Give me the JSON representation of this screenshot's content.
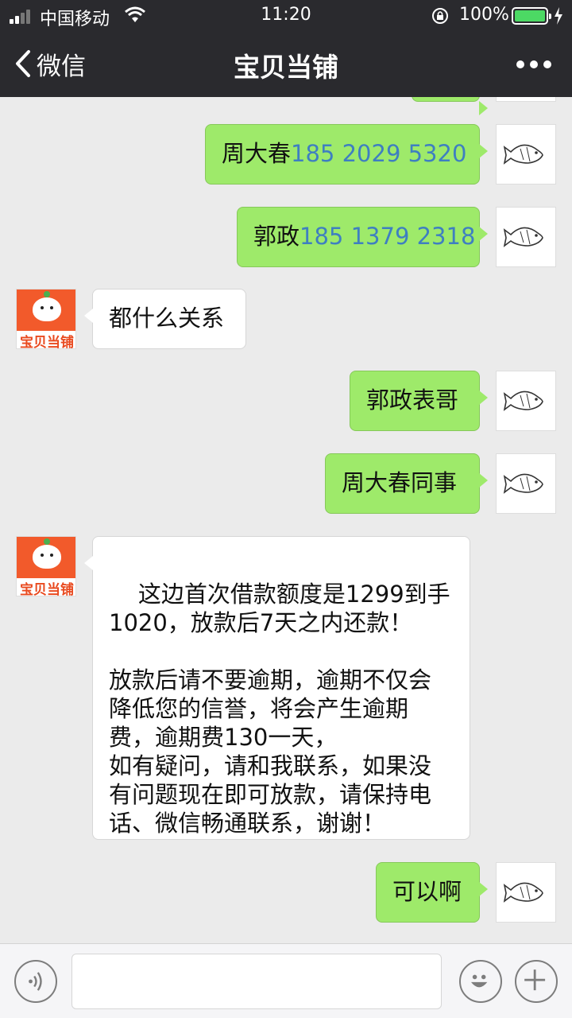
{
  "status_bar": {
    "carrier": "中国移动",
    "time": "11:20",
    "battery": "100%",
    "battery_level": 1.0
  },
  "nav": {
    "back_label": "微信",
    "title": "宝贝当铺",
    "icons": [
      "chevron-left-icon",
      "more-icon"
    ]
  },
  "messages": [
    {
      "sender": "me",
      "name": "周大春",
      "phone": "185 2029 5320"
    },
    {
      "sender": "me",
      "name": "郭政",
      "phone": "185 1379 2318"
    },
    {
      "sender": "shop",
      "text": "都什么关系"
    },
    {
      "sender": "me",
      "text": "郭政表哥"
    },
    {
      "sender": "me",
      "text": "周大春同事"
    },
    {
      "sender": "shop",
      "text": "这边首次借款额度是1299到手\n1020，放款后7天之内还款！\n\n放款后请不要逾期，逾期不仅会\n降低您的信誉，将会产生逾期\n费，逾期费130一天，\n如有疑问，请和我联系，如果没\n有问题现在即可放款，请保持电\n话、微信畅通联系，谢谢！"
    },
    {
      "sender": "me",
      "text": "可以啊"
    }
  ],
  "shop_avatar": {
    "label": "宝贝当铺"
  },
  "input_bar": {
    "icons": [
      "voice-icon",
      "emoji-icon",
      "plus-icon"
    ],
    "value": ""
  },
  "colors": {
    "nav_bg": "#2a2a2e",
    "chat_bg": "#ebebeb",
    "my_bubble": "#9eea6a",
    "phone_link": "#3e7fc1",
    "shop_brand": "#f25a2b"
  }
}
